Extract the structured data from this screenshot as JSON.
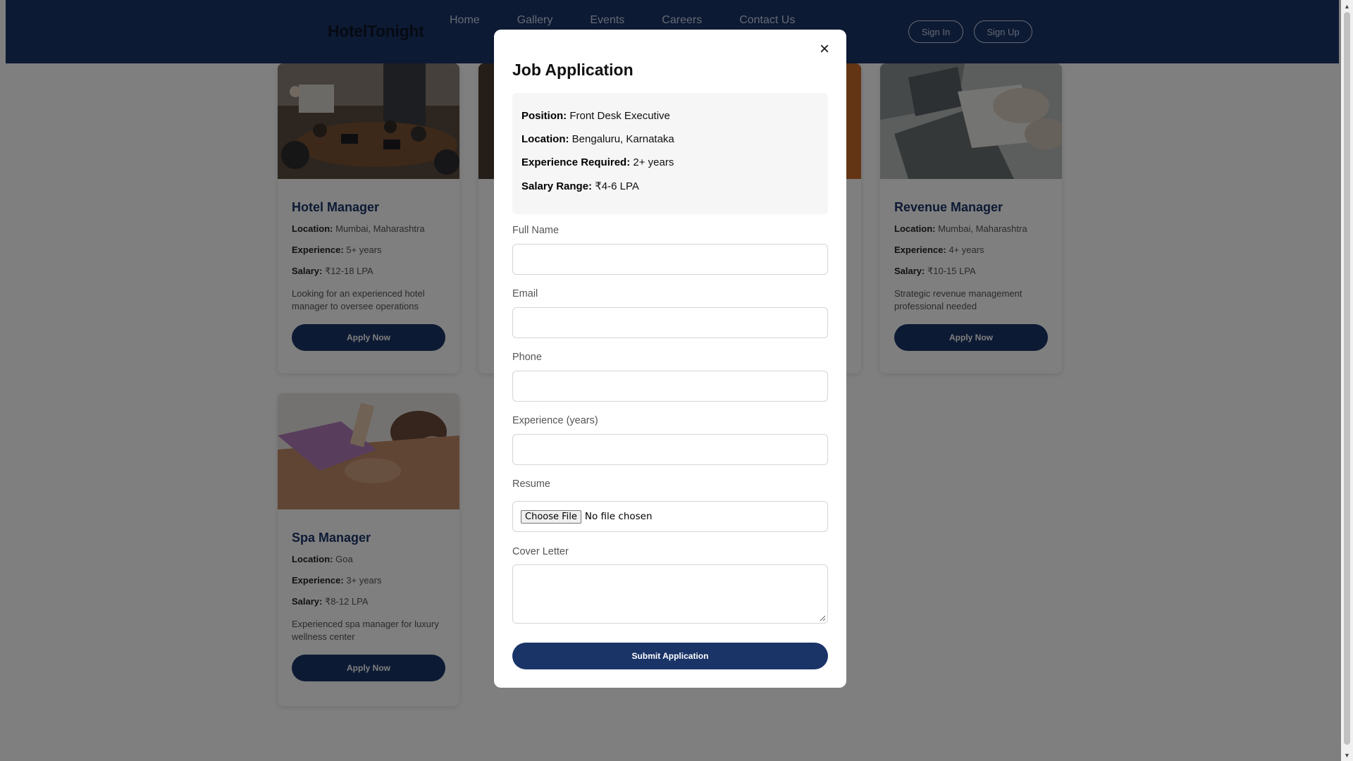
{
  "header": {
    "logo": "HotelTonight",
    "nav": [
      "Home",
      "Gallery",
      "Events",
      "Careers",
      "Contact Us"
    ],
    "sign_in": "Sign In",
    "sign_up": "Sign Up"
  },
  "jobs": [
    {
      "title": "Hotel Manager",
      "location_label": "Location:",
      "location": " Mumbai, Maharashtra",
      "experience_label": "Experience:",
      "experience": " 5+ years",
      "salary_label": "Salary:",
      "salary": " ₹12-18 LPA",
      "description": "Looking for an experienced hotel manager to oversee operations",
      "button": "Apply Now"
    },
    {
      "title": "Revenue Manager",
      "location_label": "Location:",
      "location": " Mumbai, Maharashtra",
      "experience_label": "Experience:",
      "experience": " 4+ years",
      "salary_label": "Salary:",
      "salary": " ₹10-15 LPA",
      "description": "Strategic revenue management professional needed",
      "button": "Apply Now"
    },
    {
      "title": "Spa Manager",
      "location_label": "Location:",
      "location": " Goa",
      "experience_label": "Experience:",
      "experience": " 3+ years",
      "salary_label": "Salary:",
      "salary": " ₹8-12 LPA",
      "description": "Experienced spa manager for luxury wellness center",
      "button": "Apply Now"
    }
  ],
  "modal": {
    "close": "×",
    "title": "Job Application",
    "position_label": "Position:",
    "position": " Front Desk Executive",
    "location_label": "Location:",
    "location": " Bengaluru, Karnataka",
    "experience_label": "Experience Required:",
    "experience": " 2+ years",
    "salary_label": "Salary Range:",
    "salary": " ₹4-6 LPA",
    "fields": {
      "full_name": "Full Name",
      "email": "Email",
      "phone": "Phone",
      "experience": "Experience (years)",
      "resume": "Resume",
      "cover_letter": "Cover Letter"
    },
    "file_button": "Choose File",
    "file_status": "No file chosen",
    "submit": "Submit Application"
  },
  "colors": {
    "primary": "#1a3468",
    "overlay": "rgba(0,0,0,0.5)"
  }
}
